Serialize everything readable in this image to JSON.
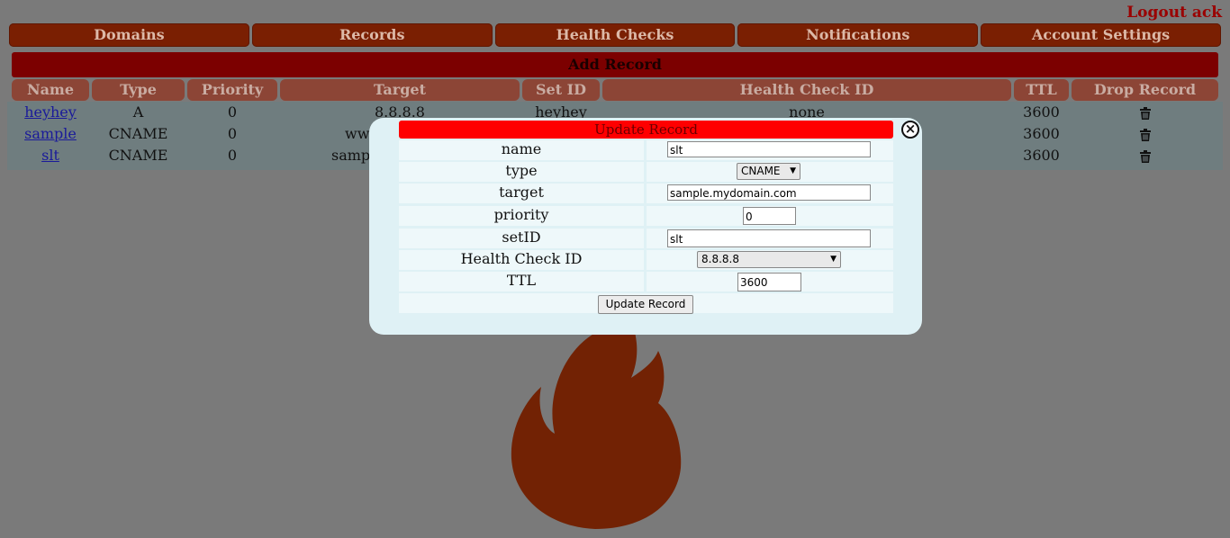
{
  "header": {
    "logout_label": "Logout ack"
  },
  "nav": {
    "tabs": [
      "Domains",
      "Records",
      "Health Checks",
      "Notifications",
      "Account Settings"
    ]
  },
  "add_record_label": "Add Record",
  "table": {
    "headers": [
      "Name",
      "Type",
      "Priority",
      "Target",
      "Set ID",
      "Health Check ID",
      "TTL",
      "Drop Record"
    ],
    "rows": [
      {
        "name": "heyhey",
        "type": "A",
        "priority": "0",
        "target": "8.8.8.8",
        "setid": "heyhey",
        "hcid": "none",
        "ttl": "3600"
      },
      {
        "name": "sample",
        "type": "CNAME",
        "priority": "0",
        "target": "www",
        "setid": "",
        "hcid": "",
        "ttl": "3600"
      },
      {
        "name": "slt",
        "type": "CNAME",
        "priority": "0",
        "target": "sampl",
        "setid": "",
        "hcid": "",
        "ttl": "3600"
      }
    ],
    "drop_icon": "trash-icon"
  },
  "modal": {
    "title": "Update Record",
    "close_icon": "close-icon",
    "fields": {
      "name": {
        "label": "name",
        "value": "slt"
      },
      "type": {
        "label": "type",
        "value": "CNAME"
      },
      "target": {
        "label": "target",
        "value": "sample.mydomain.com"
      },
      "priority": {
        "label": "priority",
        "value": "0"
      },
      "setid": {
        "label": "setID",
        "value": "slt"
      },
      "hcid": {
        "label": "Health Check ID",
        "value": "8.8.8.8"
      },
      "ttl": {
        "label": "TTL",
        "value": "3600"
      }
    },
    "submit_label": "Update Record"
  },
  "colors": {
    "background": "#7a7a7a",
    "nav_tab": "#7a1f02",
    "add_bar": "#7c0000",
    "header_cell": "#8c4536",
    "modal_bg": "#dff1f5",
    "modal_title": "#ff0000",
    "flame": "#722204"
  },
  "decor": {
    "background_logo": "flame-logo"
  }
}
